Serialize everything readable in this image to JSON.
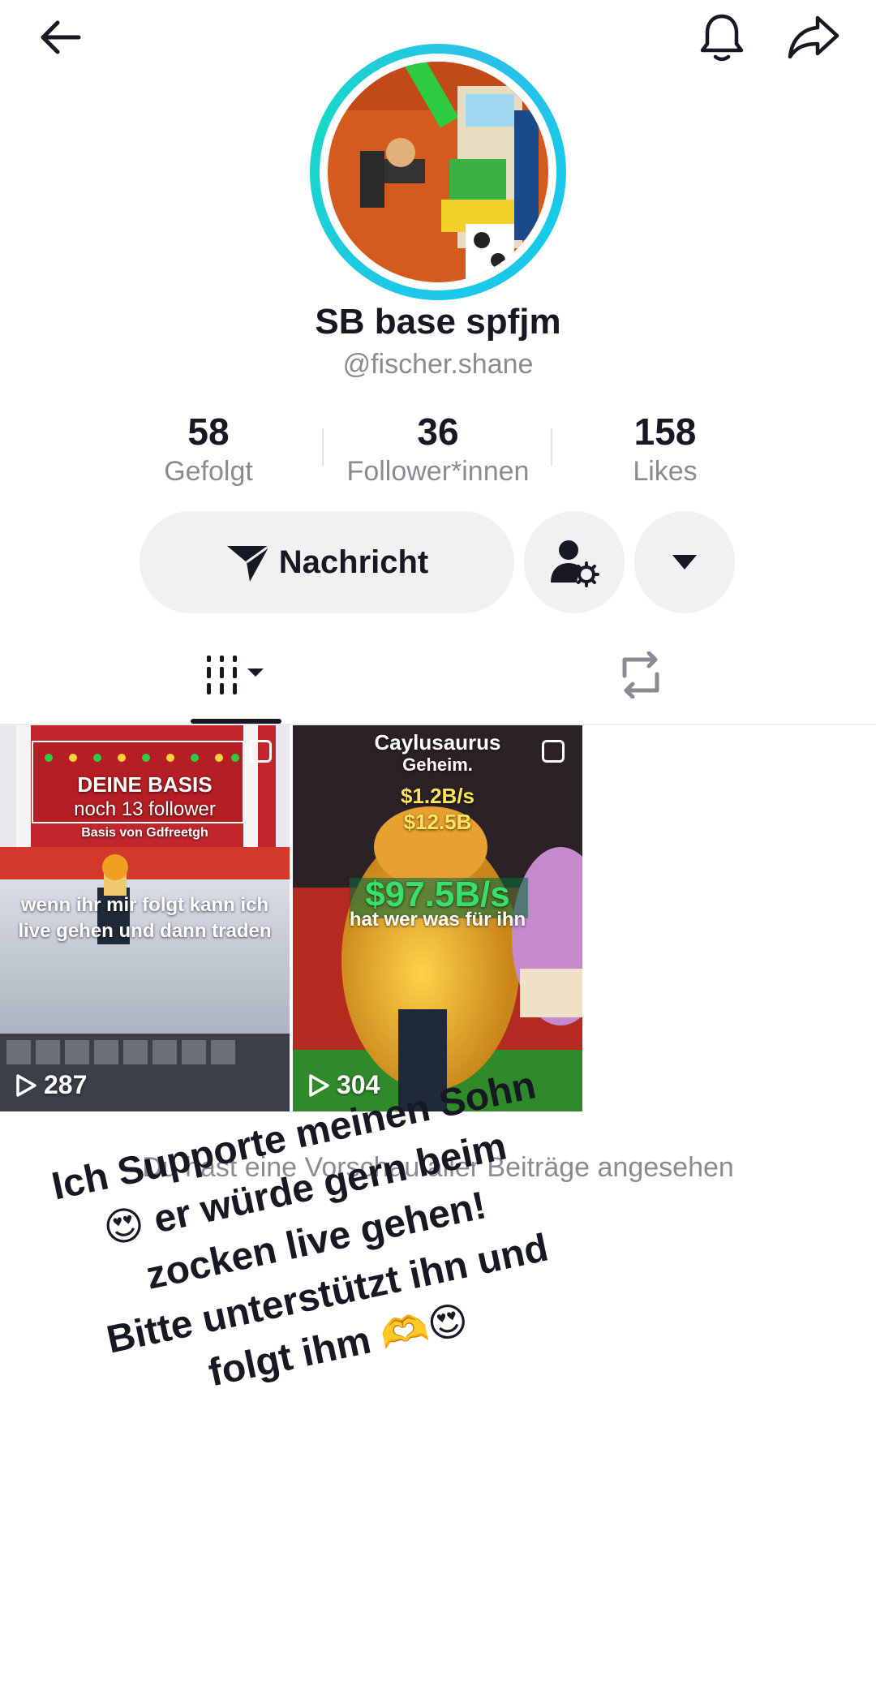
{
  "profile": {
    "display_name": "SB base spfjm",
    "handle": "@fischer.shane"
  },
  "stats": [
    {
      "value": "58",
      "label": "Gefolgt"
    },
    {
      "value": "36",
      "label": "Follower*innen"
    },
    {
      "value": "158",
      "label": "Likes"
    }
  ],
  "actions": {
    "message_label": "Nachricht"
  },
  "icons": {
    "back": "back-arrow-icon",
    "bell": "bell-icon",
    "share": "share-icon",
    "message": "send-icon",
    "friend_settings": "user-settings-icon",
    "more": "caret-down-icon",
    "videos_tab": "grid-bars-icon",
    "reposts_tab": "repost-icon",
    "play": "play-icon"
  },
  "videos": [
    {
      "views": "287",
      "scene_text": [
        "DEINE BASIS",
        "noch 13 follower",
        "Basis von Gdfreetgh"
      ],
      "caption": [
        "wenn ihr mir folgt kann ich",
        "live gehen und dann traden"
      ]
    },
    {
      "views": "304",
      "scene_text": [
        "Caylusaurus",
        "Geheim.",
        "$1.2B/s",
        "$12.5B",
        "$97.5B/s"
      ],
      "caption": [
        "hat wer was für ihn"
      ]
    }
  ],
  "preview_note": "Du hast eine Vorschau aller Beiträge angesehen",
  "sticker": {
    "lines": [
      "Ich Supporte meinen Sohn",
      "😍 er würde gern beim",
      "zocken live gehen!",
      "Bitte unterstützt ihn und",
      "folgt ihm 🫶😍"
    ]
  },
  "colors": {
    "avatar_ring": "#1ec7e8",
    "button_bg": "#f1f1f2",
    "text_primary": "#161823",
    "text_secondary": "#8a8b91"
  }
}
